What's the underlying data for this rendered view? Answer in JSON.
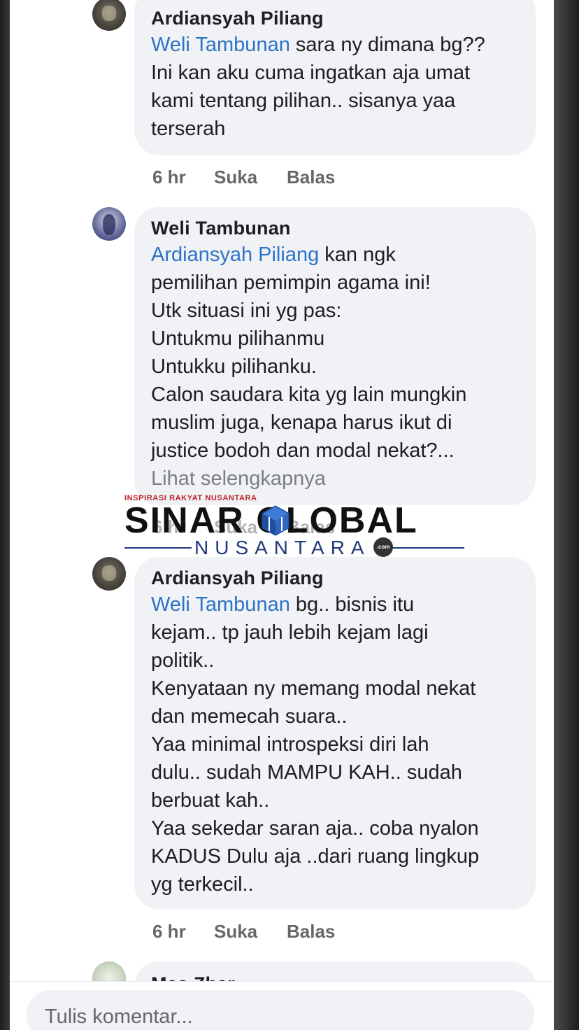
{
  "comments": [
    {
      "author": "Ardiansyah Piliang",
      "mention": "Weli Tambunan",
      "text": " sara ny dimana bg??\nIni kan aku cuma ingatkan aja umat kami tentang pilihan.. sisanya yaa terserah",
      "time": "6 hr",
      "like_label": "Suka",
      "reply_label": "Balas"
    },
    {
      "author": "Weli Tambunan",
      "mention": "Ardiansyah Piliang",
      "text": " kan ngk\npemilihan pemimpin agama ini!\nUtk situasi ini yg pas:\nUntukmu pilihanmu\nUntukku pilihanku.\nCalon saudara kita yg lain mungkin\nmuslim juga, kenapa harus ikut di\njustice bodoh dan modal nekat?...",
      "see_more": "Lihat selengkapnya",
      "time": "6 hr",
      "like_label": "Suka",
      "reply_label": "Balas"
    },
    {
      "author": "Ardiansyah Piliang",
      "mention": "Weli Tambunan",
      "text": " bg.. bisnis itu\nkejam.. tp jauh lebih kejam lagi\npolitik..\nKenyataan ny memang modal nekat\ndan memecah suara..\nYaa minimal introspeksi diri lah\ndulu.. sudah MAMPU KAH..  sudah\nberbuat kah..\nYaa sekedar saran aja.. coba nyalon\nKADUS Dulu aja ..dari ruang lingkup\nyg terkecil..",
      "time": "6 hr",
      "like_label": "Suka",
      "reply_label": "Balas"
    },
    {
      "author": "Mas Zhar"
    }
  ],
  "watermark": {
    "tagline": "INSPIRASI RAKYAT NUSANTARA",
    "name": "SINAR GLOBAL",
    "sub": "NUSANTARA",
    "domain": ".com"
  },
  "composer": {
    "placeholder": "Tulis komentar..."
  }
}
